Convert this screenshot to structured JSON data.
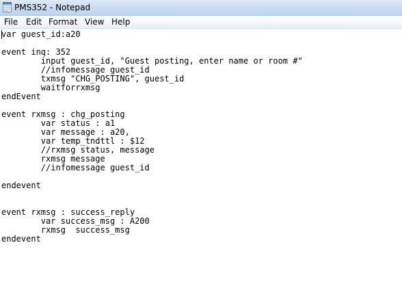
{
  "window": {
    "title": "PMS352 - Notepad"
  },
  "menu": {
    "file": "File",
    "edit": "Edit",
    "format": "Format",
    "view": "View",
    "help": "Help"
  },
  "editor": {
    "lines": [
      "var guest_id:a20",
      "",
      "event inq: 352",
      "        input guest_id, \"Guest posting, enter name or room #\"",
      "        //infomessage guest_id",
      "        txmsg \"CHG_POSTING\", guest_id",
      "        waitforrxmsg",
      "endEvent",
      "",
      "event rxmsg : chg_posting",
      "        var status : a1",
      "        var message : a20,",
      "        var temp_tndttl : $12",
      "        //rxmsg status, message",
      "        rxmsg message",
      "        //infomessage guest_id",
      "",
      "endevent",
      "",
      "",
      "event rxmsg : success_reply",
      "        var success_msg : A200",
      "        rxmsg  success_msg",
      "endevent"
    ]
  },
  "icons": {
    "app": "notepad-icon"
  }
}
